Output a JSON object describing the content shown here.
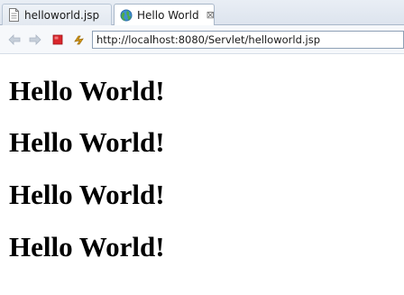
{
  "tabs": [
    {
      "label": "helloworld.jsp",
      "active": false,
      "icon": "jsp-file-icon"
    },
    {
      "label": "Hello World",
      "active": true,
      "icon": "globe-icon",
      "close_glyph": "⊠"
    }
  ],
  "toolbar": {
    "back_icon": "back-arrow-icon",
    "forward_icon": "forward-arrow-icon",
    "stop_icon": "stop-icon",
    "refresh_icon": "refresh-icon",
    "url": "http://localhost:8080/Servlet/helloworld.jsp"
  },
  "page": {
    "headings": [
      "Hello World!",
      "Hello World!",
      "Hello World!",
      "Hello World!"
    ]
  },
  "colors": {
    "stop_red": "#d9262b",
    "refresh_gold": "#e0a21a",
    "nav_disabled": "#b9c3cf",
    "tab_strip": "#dde4ee"
  }
}
